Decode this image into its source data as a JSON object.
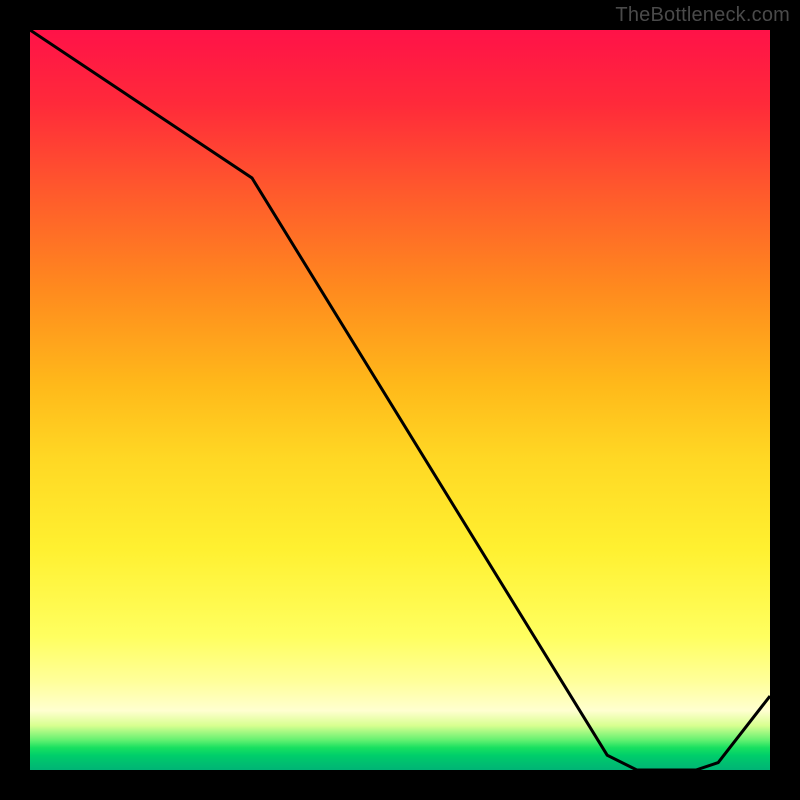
{
  "attribution": "TheBottleneck.com",
  "chart_data": {
    "type": "line",
    "title": "",
    "xlabel": "",
    "ylabel": "",
    "xlim": [
      0,
      100
    ],
    "ylim": [
      0,
      100
    ],
    "x": [
      0,
      30,
      78,
      82,
      90,
      93,
      100
    ],
    "values": [
      100,
      80,
      2,
      0,
      0,
      1,
      10
    ],
    "note": "y interpreted as percentage height within plot; curve from raster"
  },
  "colors": {
    "background": "#000000",
    "curve": "#000000",
    "gradient_top": "#ff1248",
    "gradient_bottom": "#00b475"
  }
}
